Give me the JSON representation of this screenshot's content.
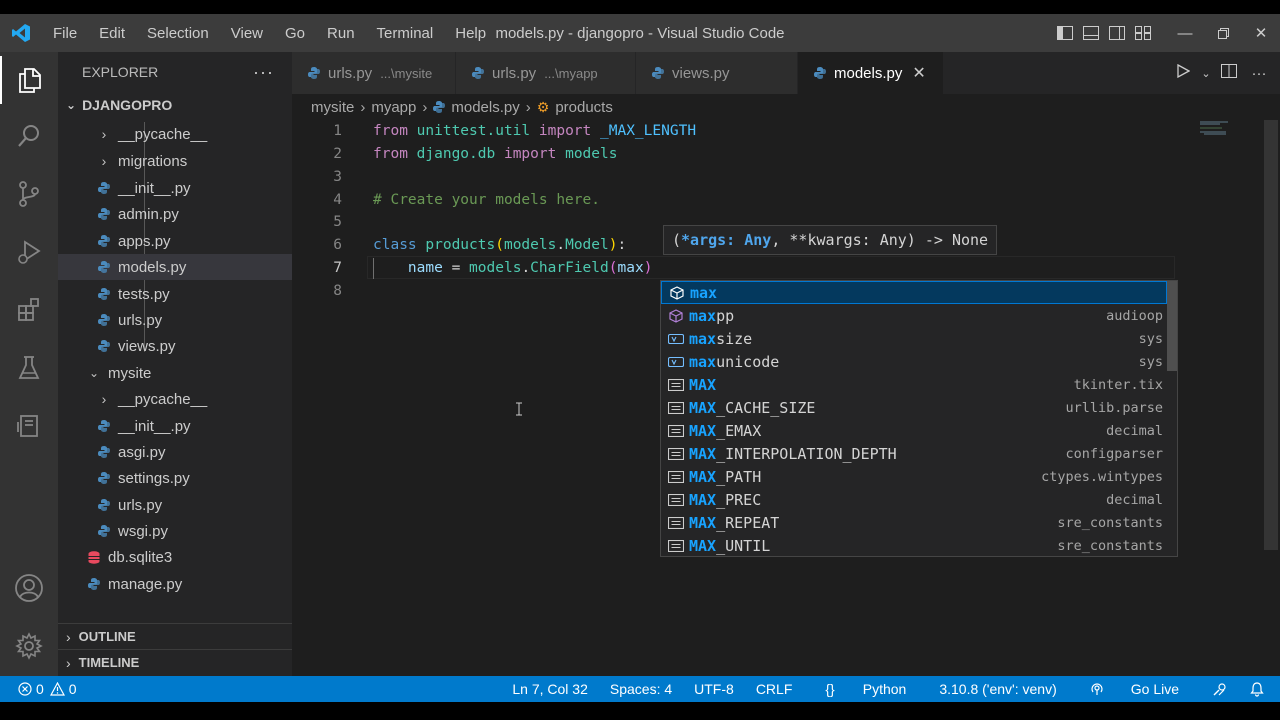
{
  "titlebar": {
    "menu": [
      "File",
      "Edit",
      "Selection",
      "View",
      "Go",
      "Run",
      "Terminal",
      "Help"
    ],
    "title": "models.py - djangopro - Visual Studio Code"
  },
  "sidebar": {
    "header": "EXPLORER",
    "root": "DJANGOPRO",
    "items": [
      {
        "label": "__pycache__",
        "type": "folder"
      },
      {
        "label": "migrations",
        "type": "folder"
      },
      {
        "label": "__init__.py",
        "type": "py"
      },
      {
        "label": "admin.py",
        "type": "py"
      },
      {
        "label": "apps.py",
        "type": "py"
      },
      {
        "label": "models.py",
        "type": "py",
        "selected": true
      },
      {
        "label": "tests.py",
        "type": "py"
      },
      {
        "label": "urls.py",
        "type": "py"
      },
      {
        "label": "views.py",
        "type": "py"
      },
      {
        "label": "mysite",
        "type": "folder-open"
      },
      {
        "label": "__pycache__",
        "type": "folder"
      },
      {
        "label": "__init__.py",
        "type": "py"
      },
      {
        "label": "asgi.py",
        "type": "py"
      },
      {
        "label": "settings.py",
        "type": "py"
      },
      {
        "label": "urls.py",
        "type": "py"
      },
      {
        "label": "wsgi.py",
        "type": "py"
      },
      {
        "label": "db.sqlite3",
        "type": "db"
      },
      {
        "label": "manage.py",
        "type": "py"
      }
    ],
    "outline": "OUTLINE",
    "timeline": "TIMELINE"
  },
  "tabs": [
    {
      "label": "urls.py",
      "desc": "...\\mysite"
    },
    {
      "label": "urls.py",
      "desc": "...\\myapp"
    },
    {
      "label": "views.py",
      "desc": ""
    },
    {
      "label": "models.py",
      "desc": "",
      "active": true
    }
  ],
  "breadcrumb": [
    "mysite",
    "myapp",
    "models.py",
    "products"
  ],
  "editor": {
    "line_numbers": [
      "1",
      "2",
      "3",
      "4",
      "5",
      "6",
      "7",
      "8"
    ],
    "signature": {
      "open": "(",
      "param": "*args: Any",
      "rest": ", **kwargs: Any) -> None"
    },
    "suggestions": [
      {
        "match": "max",
        "rest": "",
        "detail": ""
      },
      {
        "match": "max",
        "rest": "pp",
        "detail": "audioop"
      },
      {
        "match": "max",
        "rest": "size",
        "detail": "sys"
      },
      {
        "match": "max",
        "rest": "unicode",
        "detail": "sys"
      },
      {
        "match": "MAX",
        "rest": "",
        "detail": "tkinter.tix"
      },
      {
        "match": "MAX",
        "rest": "_CACHE_SIZE",
        "detail": "urllib.parse"
      },
      {
        "match": "MAX",
        "rest": "_EMAX",
        "detail": "decimal"
      },
      {
        "match": "MAX",
        "rest": "_INTERPOLATION_DEPTH",
        "detail": "configparser"
      },
      {
        "match": "MAX",
        "rest": "_PATH",
        "detail": "ctypes.wintypes"
      },
      {
        "match": "MAX",
        "rest": "_PREC",
        "detail": "decimal"
      },
      {
        "match": "MAX",
        "rest": "_REPEAT",
        "detail": "sre_constants"
      },
      {
        "match": "MAX",
        "rest": "_UNTIL",
        "detail": "sre_constants"
      }
    ]
  },
  "statusbar": {
    "errors": "0",
    "warnings": "0",
    "position": "Ln 7, Col 32",
    "spaces": "Spaces: 4",
    "encoding": "UTF-8",
    "eol": "CRLF",
    "language": "Python",
    "interpreter": "3.10.8 ('env': venv)",
    "golive": "Go Live"
  }
}
